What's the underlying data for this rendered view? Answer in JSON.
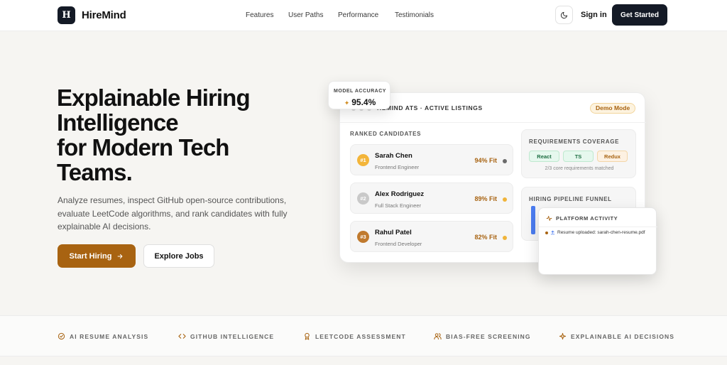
{
  "colors": {
    "accent": "#a86311",
    "dark": "#141a26",
    "background": "#f6f5f2",
    "green": "#1f6f43"
  },
  "header": {
    "logo_mark": "H",
    "brand": "HireMind",
    "nav": [
      "Features",
      "User Paths",
      "Performance",
      "Testimonials"
    ],
    "theme_icon": "moon-icon",
    "sign_in": "Sign in",
    "get_started": "Get Started"
  },
  "hero": {
    "title_lines": [
      "Explainable Hiring",
      "Intelligence",
      "for Modern Tech",
      "Teams."
    ],
    "subtitle": "Analyze resumes, inspect GitHub open-source contributions, evaluate LeetCode algorithms, and rank candidates with fully explainable AI decisions.",
    "primary_button": "Start Hiring",
    "secondary_button": "Explore Jobs"
  },
  "dashboard": {
    "title": "REMIND ATS · ACTIVE LISTINGS",
    "demo_badge": "Demo Mode",
    "ranked_label": "RANKED CANDIDATES",
    "candidates": [
      {
        "rank": "#1",
        "name": "Sarah Chen",
        "role": "Frontend Engineer",
        "fit": "94% Fit",
        "rank_color": "#f3b53a",
        "dot_color": "#6b6b6b"
      },
      {
        "rank": "#2",
        "name": "Alex Rodriguez",
        "role": "Full Stack Engineer",
        "fit": "89% Fit",
        "rank_color": "#c9c9c9",
        "dot_color": "#f0b43a"
      },
      {
        "rank": "#3",
        "name": "Rahul Patel",
        "role": "Frontend Developer",
        "fit": "82% Fit",
        "rank_color": "#c07a2e",
        "dot_color": "#f0b43a"
      }
    ],
    "requirements": {
      "label": "REQUIREMENTS COVERAGE",
      "tags": [
        {
          "text": "React",
          "status": "ok"
        },
        {
          "text": "TS",
          "status": "ok"
        },
        {
          "text": "Redux",
          "status": "miss"
        }
      ],
      "note": "2/3 core requirements matched"
    },
    "funnel_label": "HIRING PIPELINE FUNNEL"
  },
  "accuracy": {
    "label": "MODEL ACCURACY",
    "value": "95.4%"
  },
  "activity": {
    "label": "PLATFORM ACTIVITY",
    "entry": "Resume uploaded: sarah-chen-resume.pdf"
  },
  "features": [
    {
      "label": "AI RESUME ANALYSIS",
      "icon": "check-circle-icon"
    },
    {
      "label": "GITHUB INTELLIGENCE",
      "icon": "code-icon"
    },
    {
      "label": "LEETCODE ASSESSMENT",
      "icon": "award-icon"
    },
    {
      "label": "BIAS-FREE SCREENING",
      "icon": "users-icon"
    },
    {
      "label": "EXPLAINABLE AI DECISIONS",
      "icon": "sparkle-icon"
    }
  ]
}
